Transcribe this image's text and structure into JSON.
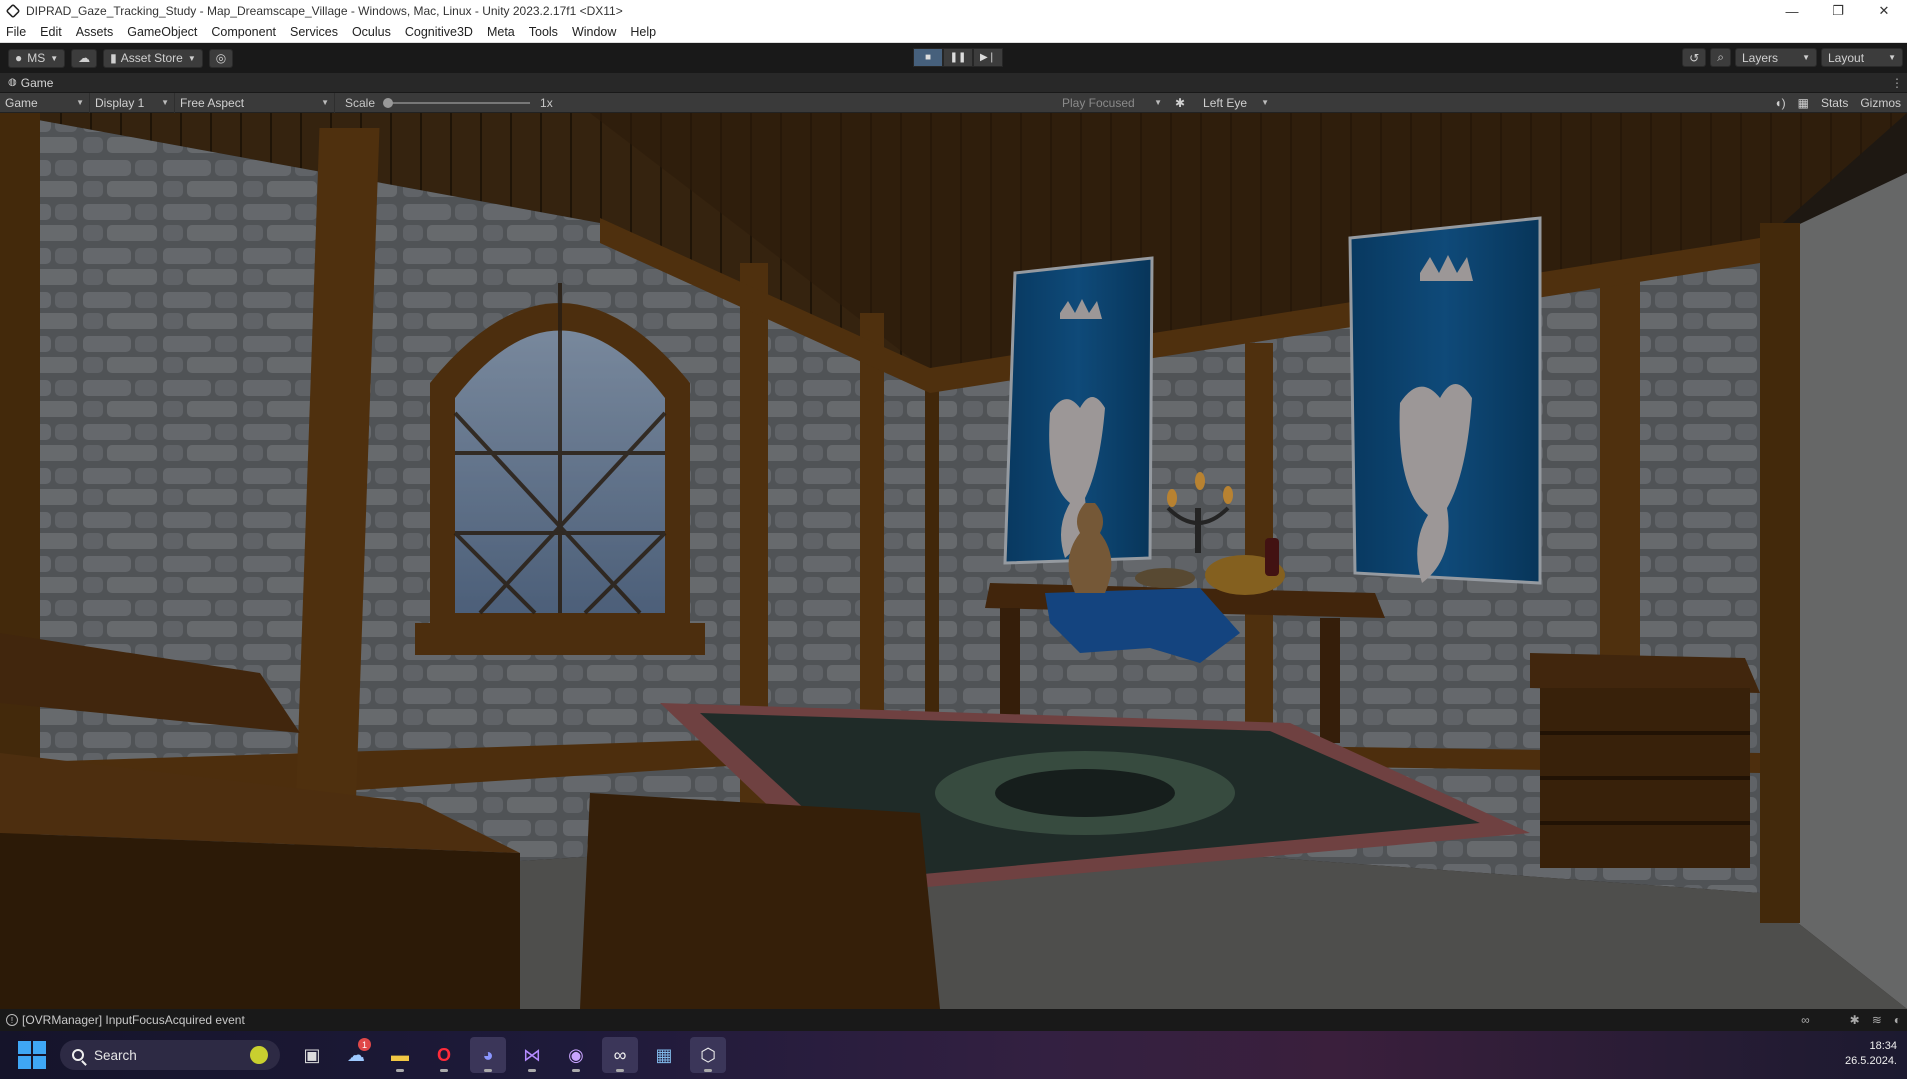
{
  "window": {
    "title": "DIPRAD_Gaze_Tracking_Study - Map_Dreamscape_Village - Windows, Mac, Linux - Unity 2023.2.17f1 <DX11>",
    "controls": [
      "—",
      "❐",
      "✕"
    ]
  },
  "menu": [
    "File",
    "Edit",
    "Assets",
    "GameObject",
    "Component",
    "Services",
    "Oculus",
    "Cognitive3D",
    "Meta",
    "Tools",
    "Window",
    "Help"
  ],
  "toolbar": {
    "account_label": "MS",
    "asset_store_label": "Asset Store",
    "layers_label": "Layers",
    "layout_label": "Layout",
    "play_state": "playing"
  },
  "game_tab": {
    "label": "Game"
  },
  "game_bar": {
    "mode": "Game",
    "display": "Display 1",
    "aspect": "Free Aspect",
    "scale_label": "Scale",
    "scale_value": "1x",
    "play_mode": "Play Focused",
    "eye": "Left Eye",
    "stats_label": "Stats",
    "gizmos_label": "Gizmos"
  },
  "viewport": {
    "scene_description_icons": [
      "stone-wall",
      "window",
      "banner",
      "table",
      "chest",
      "rug",
      "bench"
    ]
  },
  "status": {
    "message": "[OVRManager] InputFocusAcquired event"
  },
  "taskbar": {
    "search_placeholder": "Search",
    "apps": [
      {
        "name": "task-view",
        "glyph": "▣"
      },
      {
        "name": "weather",
        "glyph": "☁",
        "badge": "1"
      },
      {
        "name": "file-explorer",
        "glyph": "▬"
      },
      {
        "name": "opera",
        "glyph": "O"
      },
      {
        "name": "discord",
        "glyph": "◕"
      },
      {
        "name": "visual-studio",
        "glyph": "⋈"
      },
      {
        "name": "github",
        "glyph": "◉"
      },
      {
        "name": "meta",
        "glyph": "∞"
      },
      {
        "name": "image-viewer",
        "glyph": "▦"
      },
      {
        "name": "unity",
        "glyph": "⬡"
      }
    ],
    "time": "18:34",
    "date": "26.5.2024."
  }
}
